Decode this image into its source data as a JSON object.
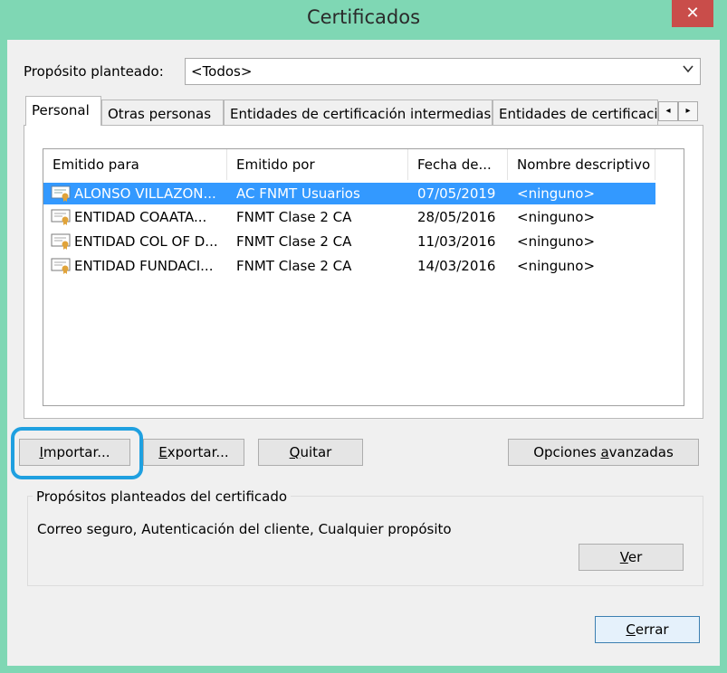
{
  "window": {
    "title": "Certificados",
    "close_glyph": "✕"
  },
  "purpose": {
    "label": "Propósito planteado:",
    "selected": "<Todos>"
  },
  "tabs": [
    {
      "label": "Personal"
    },
    {
      "label": "Otras personas"
    },
    {
      "label": "Entidades de certificación intermedias"
    },
    {
      "label": "Entidades de certificaci"
    }
  ],
  "tab_scroll": {
    "left": "◂",
    "right": "▸"
  },
  "columns": [
    "Emitido para",
    "Emitido por",
    "Fecha de...",
    "Nombre descriptivo"
  ],
  "rows": [
    {
      "issued_to": "ALONSO VILLAZON...",
      "issued_by": "AC FNMT Usuarios",
      "date": "07/05/2019",
      "friendly": "<ninguno>",
      "selected": true
    },
    {
      "issued_to": "ENTIDAD COAATA...",
      "issued_by": "FNMT Clase 2 CA",
      "date": "28/05/2016",
      "friendly": "<ninguno>"
    },
    {
      "issued_to": "ENTIDAD COL OF D...",
      "issued_by": "FNMT Clase 2 CA",
      "date": "11/03/2016",
      "friendly": "<ninguno>"
    },
    {
      "issued_to": "ENTIDAD FUNDACI...",
      "issued_by": "FNMT Clase 2 CA",
      "date": "14/03/2016",
      "friendly": "<ninguno>"
    }
  ],
  "buttons": {
    "import": {
      "mn": "I",
      "rest": "mportar..."
    },
    "export": {
      "mn": "E",
      "rest": "xportar..."
    },
    "remove": {
      "mn": "Q",
      "rest": "uitar"
    },
    "advanced": {
      "pre": "Opciones ",
      "mn": "a",
      "rest": "vanzadas"
    },
    "view": {
      "mn": "V",
      "rest": "er"
    },
    "close": {
      "mn": "C",
      "rest": "errar"
    }
  },
  "purposes_group": {
    "title": "Propósitos planteados del certificado",
    "text": "Correo seguro, Autenticación del cliente, Cualquier propósito"
  },
  "colors": {
    "titlebar": "#7fd7b4",
    "selection": "#3399ff",
    "close": "#c94d4a",
    "highlight": "#1fa0e0"
  }
}
